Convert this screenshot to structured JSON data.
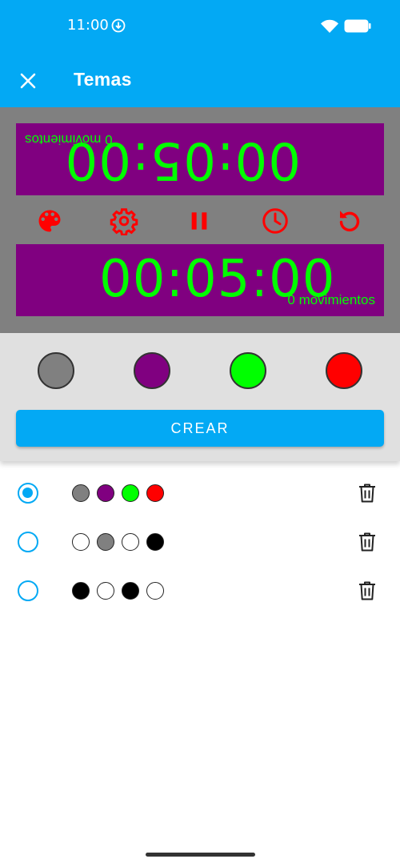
{
  "status_bar": {
    "time": "11:00"
  },
  "app_bar": {
    "title": "Temas"
  },
  "preview": {
    "top_clock": {
      "time": "00:05:00",
      "moves": "0 movimientos"
    },
    "bottom_clock": {
      "time": "00:05:00",
      "moves": "0 movimientos"
    },
    "colors": {
      "background": "#808080",
      "panel": "#800080",
      "text": "#00FF00",
      "icons": "#FF0000"
    },
    "controls": [
      "palette-icon",
      "settings-icon",
      "pause-icon",
      "clock-icon",
      "restart-icon"
    ]
  },
  "picker": {
    "swatches": [
      "#808080",
      "#800080",
      "#00FF00",
      "#FF0000"
    ],
    "create_label": "CREAR"
  },
  "themes": [
    {
      "selected": true,
      "colors": [
        "#808080",
        "#800080",
        "#00FF00",
        "#FF0000"
      ]
    },
    {
      "selected": false,
      "colors": [
        "#FFFFFF",
        "#808080",
        "#FFFFFF",
        "#000000"
      ]
    },
    {
      "selected": false,
      "colors": [
        "#000000",
        "#FFFFFF",
        "#000000",
        "#FFFFFF"
      ]
    }
  ],
  "accent": "#03A9F4"
}
